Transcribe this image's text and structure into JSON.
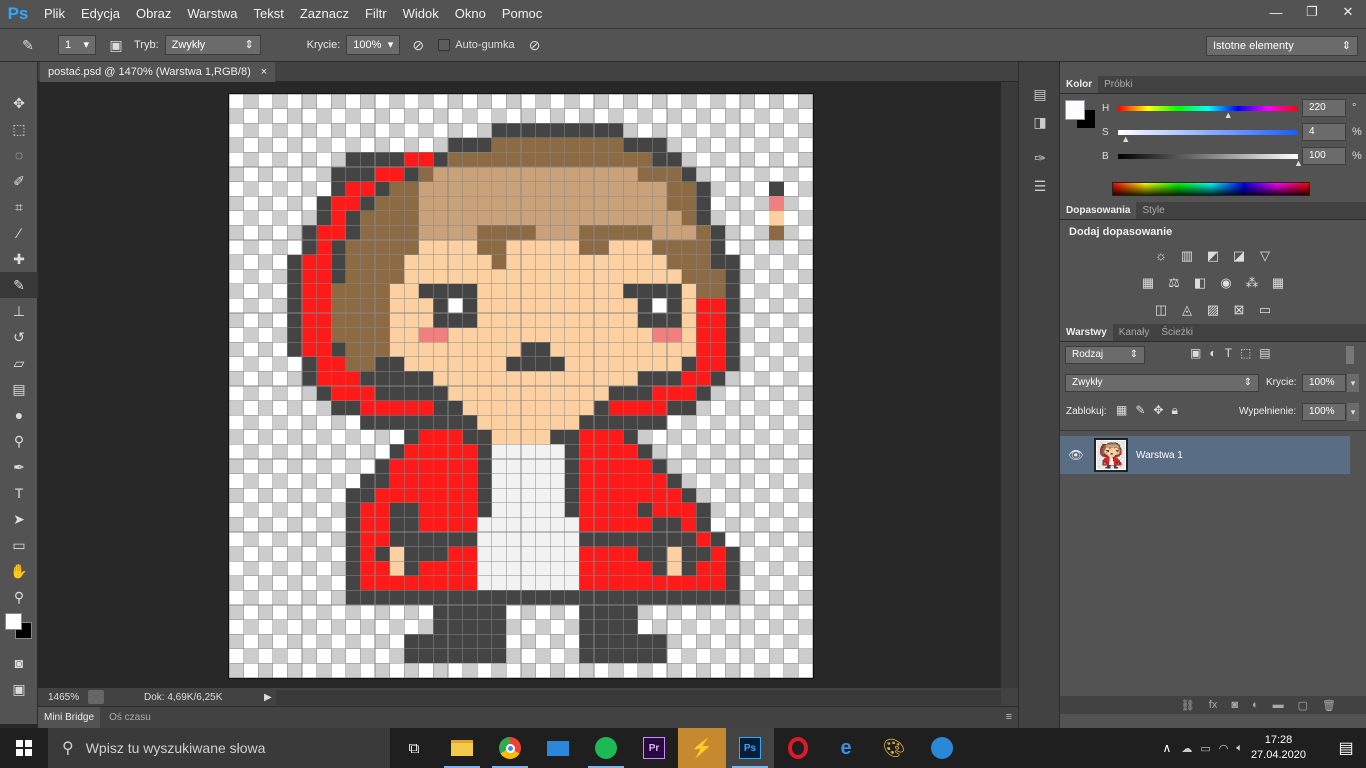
{
  "app": {
    "logo": "Ps"
  },
  "menu": [
    "Plik",
    "Edycja",
    "Obraz",
    "Warstwa",
    "Tekst",
    "Zaznacz",
    "Filtr",
    "Widok",
    "Okno",
    "Pomoc"
  ],
  "window_buttons": {
    "minimize": "—",
    "restore": "❐",
    "close": "✕"
  },
  "options_bar": {
    "brush_size": "1",
    "mode_label": "Tryb:",
    "mode_value": "Zwykły",
    "opacity_label": "Krycie:",
    "opacity_value": "100%",
    "auto_erase_label": "Auto-gumka",
    "workspace": "Istotne elementy"
  },
  "document": {
    "tab_title": "postać.psd @ 1470% (Warstwa 1,RGB/8)",
    "tab_close": "×",
    "zoom": "1465%",
    "doc_info": "Dok: 4,69K/6,25K"
  },
  "bottom_tabs": [
    "Mini Bridge",
    "Oś czasu"
  ],
  "color_panel": {
    "tabs": [
      "Kolor",
      "Próbki"
    ],
    "sliders": [
      {
        "label": "H",
        "value": "220",
        "unit": "°",
        "position": 0.61
      },
      {
        "label": "S",
        "value": "4",
        "unit": "%",
        "position": 0.04
      },
      {
        "label": "B",
        "value": "100",
        "unit": "%",
        "position": 1.0
      }
    ]
  },
  "adjustments_panel": {
    "tabs": [
      "Dopasowania",
      "Style"
    ],
    "title": "Dodaj dopasowanie"
  },
  "layers_panel": {
    "tabs": [
      "Warstwy",
      "Kanały",
      "Ścieżki"
    ],
    "filter": "Rodzaj",
    "blend_mode": "Zwykły",
    "opacity_label": "Krycie:",
    "opacity_value": "100%",
    "lock_label": "Zablokuj:",
    "fill_label": "Wypełnienie:",
    "fill_value": "100%",
    "layers": [
      {
        "name": "Warstwa 1",
        "visible": true,
        "selected": true
      }
    ]
  },
  "taskbar": {
    "search_placeholder": "Wpisz tu wyszukiwane słowa",
    "time": "17:28",
    "date": "27.04.2020"
  },
  "colors": {
    "outline": "#444444",
    "hair": "#8b6a44",
    "hair_light": "#c9a27a",
    "skin": "#fcd0a0",
    "red": "#ff1a1a",
    "white": "#f2f2f2",
    "blush": "#f08080",
    "eye": "#ffffff"
  },
  "pixel_art": {
    "grid_size": 40,
    "rows": [
      "........................................",
      "........................................",
      "..................OOOOOOOOO.............",
      "...............OOOHHHHHHHHHOOO..........",
      "........OOOORROHHHHHHHHHHHHHHOO.........",
      ".......OOORROHLLLLLLLLLLLLLLHHHO........",
      ".......ORROHHLLLLLLLLLLLLLLLLLHHO.......",
      "......ORROHHHLLLLLLLLLLLLLLLLLHHO.......",
      "......OROHHHHLLLLLLLLLLLLLLLLLLHO.......",
      ".....ORROHHHHLLLLHHHHLLLHHHHHLLLHO......",
      ".....OROHHHHHSSSSHHSSSSSHHSSSHHHHO......",
      "....ORROHHHHSSSSSSHSSSSSSSSSSSHHHOO.....",
      "....ORROHHHHSSSSSSSSSSSSSSSSSSSHHHO.....",
      "....ORRHHHHSSOOOOSSSSSSSSSSOOOOSHHO.....",
      "....ORRHHHHSSSOWOSSSSSSSSSSSOWOSRRO.....",
      "....ORRHHHHSSSOOOSSSSSSSSSSSOOOSRRO.....",
      "....ORRHHHHSSPPSSSSSSSSSSSSSSPPSRRO.....",
      "....ORROHHHSSSSSSSSSOOSSSSSSSSSSRRO.....",
      ".....ORRHHOOSSSSSSSOOOOSSSSSSSSORRO.....",
      ".....ORRROOOOOSSSSSSSSSSSSSSOOORRO......",
      "......ORRROOOOOSSSSSSSSSSSOOORRRO.......",
      ".......OORRRRROOSSSSSSSSSORRRROO........",
      ".........OOOOOOOOSSSSSSSOOOOOO..........",
      "............ORRROOSSSSOORRRO............",
      "...........ORRRRROWWWWWORRRRO...........",
      "..........ORRRRRROWWWWWORRRRRO..........",
      ".........OORRRRRROWWWWWORRRRRRO.........",
      "........OORRRRRRROWWWWWORRRRRRRO........",
      "........ORROORRRROWWWWWORRRRORRRO.......",
      "........ORROORRRRWWWWWWWRRRRROORO.......",
      "........ORROOOOOOWWWWWWWOOOOOOOORO......",
      "........OROSOOORRWWWWWWWRRRROOSOORO.....",
      "........ORRSORRRRWWWWWWWRRRRROSORRO.....",
      "........ORRRRRRRRWWWWWWWRRRRRRRRRRO.....",
      "........OOOOOOOOOOOOOOOOOOOOOOOOOOO.....",
      "..............OOOOO.....OOOO............",
      "..............OOOOO.....OOOO............",
      "............OOOOOOO.....OOOOOO..........",
      "............OOOOOOO.....OOOOOO..........",
      "........................................"
    ]
  }
}
